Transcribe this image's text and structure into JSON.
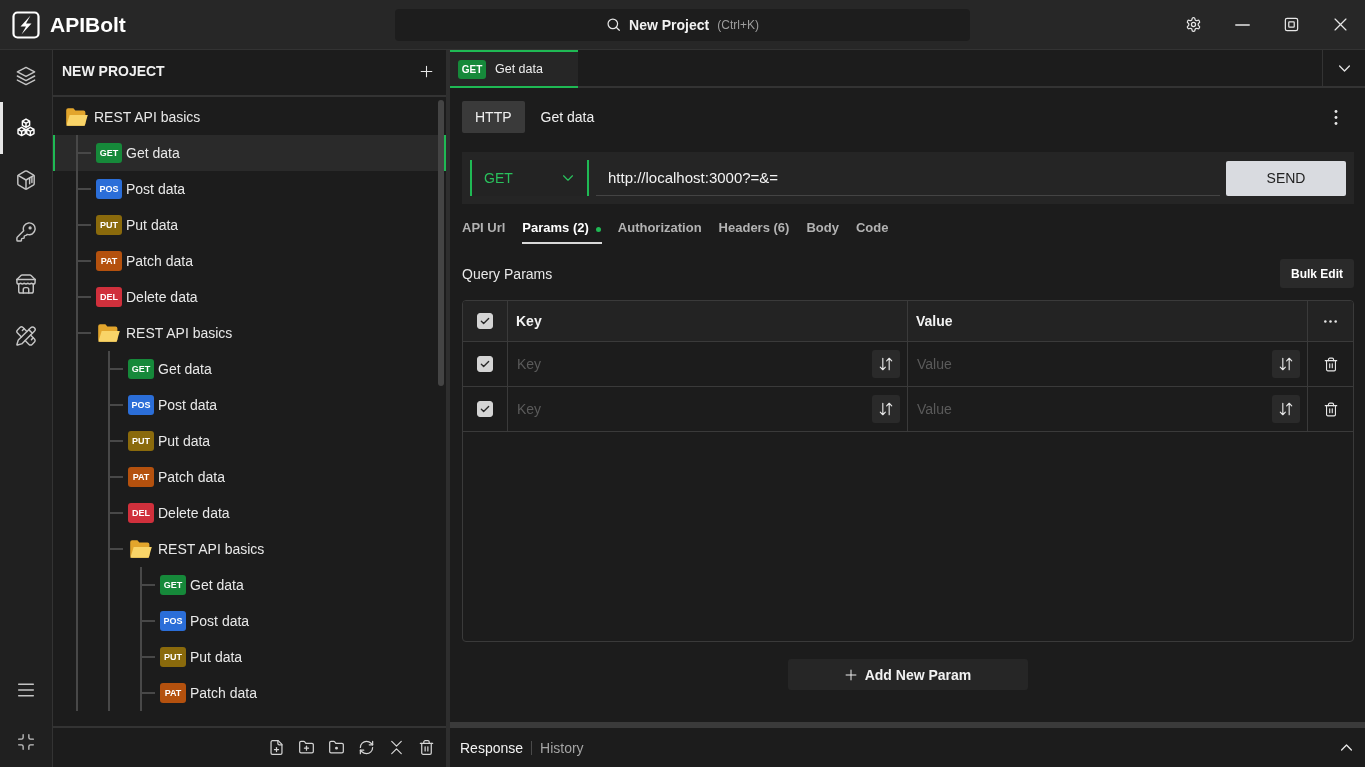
{
  "app": {
    "name": "APIBolt"
  },
  "search": {
    "label": "New Project",
    "shortcut": "(Ctrl+K)"
  },
  "rail": [
    {
      "selected": false
    },
    {
      "selected": true
    },
    {
      "selected": false
    },
    {
      "selected": false
    },
    {
      "selected": false
    },
    {
      "selected": false
    }
  ],
  "sidebar": {
    "title": "NEW PROJECT",
    "tree": [
      {
        "kind": "folder",
        "label": "REST API basics",
        "expanded": true,
        "selected": false,
        "children": [
          {
            "kind": "request",
            "method": "GET",
            "color": "#16893a",
            "label": "Get data",
            "selected": true
          },
          {
            "kind": "request",
            "method": "POS",
            "color": "#2b6ed8",
            "label": "Post data",
            "selected": false
          },
          {
            "kind": "request",
            "method": "PUT",
            "color": "#8a6a0c",
            "label": "Put data",
            "selected": false
          },
          {
            "kind": "request",
            "method": "PAT",
            "color": "#b4510e",
            "label": "Patch data",
            "selected": false
          },
          {
            "kind": "request",
            "method": "DEL",
            "color": "#d0303c",
            "label": "Delete data",
            "selected": false
          },
          {
            "kind": "folder",
            "label": "REST API basics",
            "expanded": true,
            "selected": false,
            "children": [
              {
                "kind": "request",
                "method": "GET",
                "color": "#16893a",
                "label": "Get data",
                "selected": false
              },
              {
                "kind": "request",
                "method": "POS",
                "color": "#2b6ed8",
                "label": "Post data",
                "selected": false
              },
              {
                "kind": "request",
                "method": "PUT",
                "color": "#8a6a0c",
                "label": "Put data",
                "selected": false
              },
              {
                "kind": "request",
                "method": "PAT",
                "color": "#b4510e",
                "label": "Patch data",
                "selected": false
              },
              {
                "kind": "request",
                "method": "DEL",
                "color": "#d0303c",
                "label": "Delete data",
                "selected": false
              },
              {
                "kind": "folder",
                "label": "REST API basics",
                "expanded": true,
                "selected": false,
                "children": [
                  {
                    "kind": "request",
                    "method": "GET",
                    "color": "#16893a",
                    "label": "Get data",
                    "selected": false
                  },
                  {
                    "kind": "request",
                    "method": "POS",
                    "color": "#2b6ed8",
                    "label": "Post data",
                    "selected": false
                  },
                  {
                    "kind": "request",
                    "method": "PUT",
                    "color": "#8a6a0c",
                    "label": "Put data",
                    "selected": false
                  },
                  {
                    "kind": "request",
                    "method": "PAT",
                    "color": "#b4510e",
                    "label": "Patch data",
                    "selected": false
                  }
                ]
              }
            ]
          }
        ]
      }
    ]
  },
  "tabs": [
    {
      "method": "GET",
      "color": "#16893a",
      "label": "Get data",
      "selected": true
    }
  ],
  "request": {
    "protocol": "HTTP",
    "name": "Get data",
    "method": "GET",
    "url": "http://localhost:3000?=&=",
    "send": "SEND"
  },
  "request_tabs": [
    {
      "label": "API Url",
      "selected": false,
      "modified": false
    },
    {
      "label": "Params (2)",
      "selected": true,
      "modified": true
    },
    {
      "label": "Authorization",
      "selected": false,
      "modified": false
    },
    {
      "label": "Headers (6)",
      "selected": false,
      "modified": false
    },
    {
      "label": "Body",
      "selected": false,
      "modified": false
    },
    {
      "label": "Code",
      "selected": false,
      "modified": false
    }
  ],
  "params": {
    "title": "Query Params",
    "bulk_edit": "Bulk Edit",
    "all_checked": true,
    "columns": [
      "Key",
      "Value"
    ],
    "rows": [
      {
        "checked": true,
        "key_placeholder": "Key",
        "value_placeholder": "Value"
      },
      {
        "checked": true,
        "key_placeholder": "Key",
        "value_placeholder": "Value"
      }
    ],
    "add_label": "Add New Param"
  },
  "bottom_panel": {
    "tabs": [
      {
        "label": "Response",
        "selected": true
      },
      {
        "label": "History",
        "selected": false
      }
    ]
  }
}
